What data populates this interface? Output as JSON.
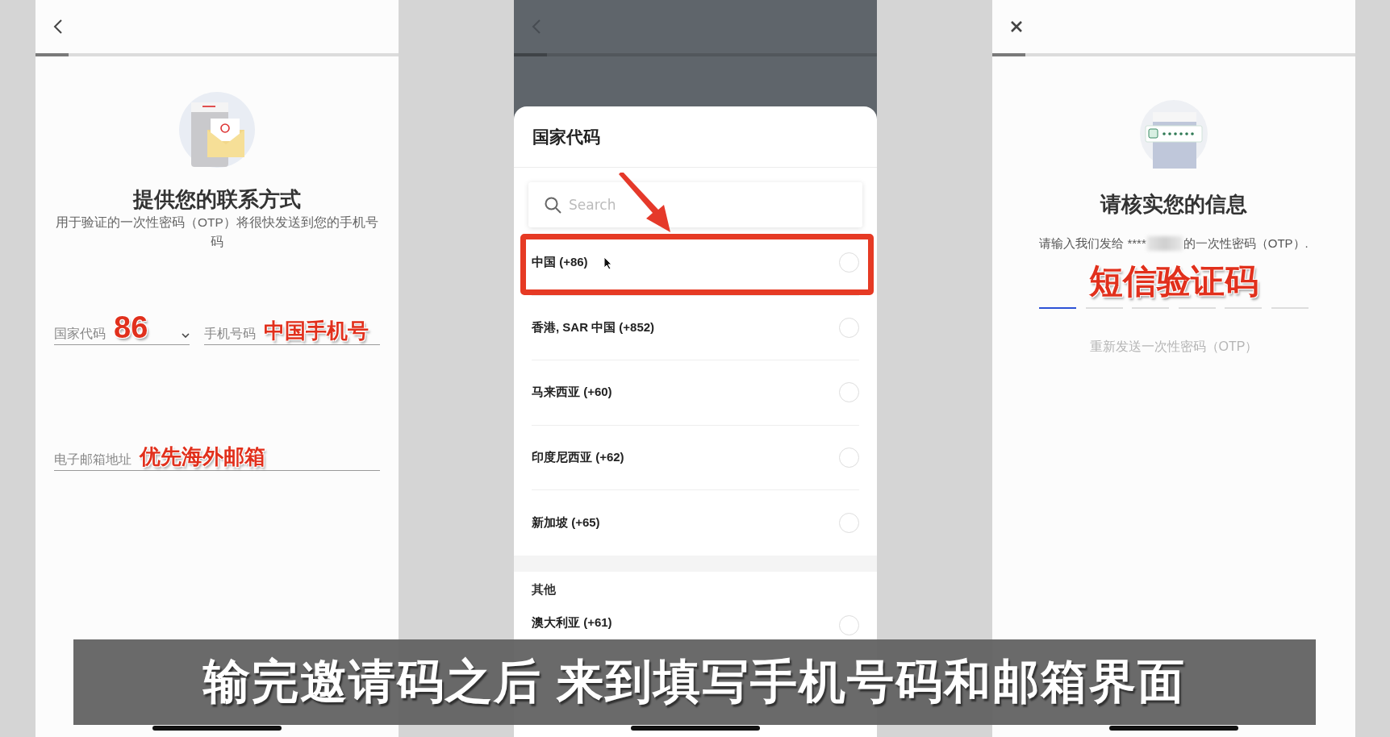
{
  "contact_screen": {
    "progress": {
      "level": 0.09
    },
    "title": "提供您的联系方式",
    "description": "用于验证的一次性密码（OTP）将很快发送到您的手机号码",
    "country_code_field": {
      "label": "国家代码",
      "annotation": "86"
    },
    "phone_field": {
      "label": "手机号码",
      "annotation": "中国手机号"
    },
    "email_field": {
      "label": "电子邮箱地址",
      "annotation": "优先海外邮箱"
    }
  },
  "country_code_sheet": {
    "progress": {
      "level": 0.09
    },
    "title": "国家代码",
    "search": {
      "placeholder": "Search"
    },
    "countries": [
      {
        "name": "中国 (+86)",
        "selected": false,
        "highlighted": true
      },
      {
        "name": "香港, SAR 中国 (+852)",
        "selected": false,
        "highlighted": false
      },
      {
        "name": "马来西亚 (+60)",
        "selected": false,
        "highlighted": false
      },
      {
        "name": "印度尼西亚 (+62)",
        "selected": false,
        "highlighted": false
      },
      {
        "name": "新加坡 (+65)",
        "selected": false,
        "highlighted": false
      }
    ],
    "others_header": "其他",
    "other_countries": [
      {
        "name": "澳大利亚 (+61)",
        "selected": false,
        "highlighted": false
      }
    ]
  },
  "verify_screen": {
    "progress": {
      "level": 0.09
    },
    "title": "请核实您的信息",
    "message_before": "请输入我们发给 ****",
    "message_after": "的一次性密码（OTP）.",
    "annotation": "短信验证码",
    "otp_slots": [
      {
        "active": true
      },
      {
        "active": false
      },
      {
        "active": false
      },
      {
        "active": false
      },
      {
        "active": false
      },
      {
        "active": false
      }
    ],
    "resend": {
      "label": "重新发送一次性密码（OTP）",
      "disabled": true
    }
  },
  "subtitle": {
    "text": "输完邀请码之后 来到填写手机号码和邮箱界面"
  }
}
